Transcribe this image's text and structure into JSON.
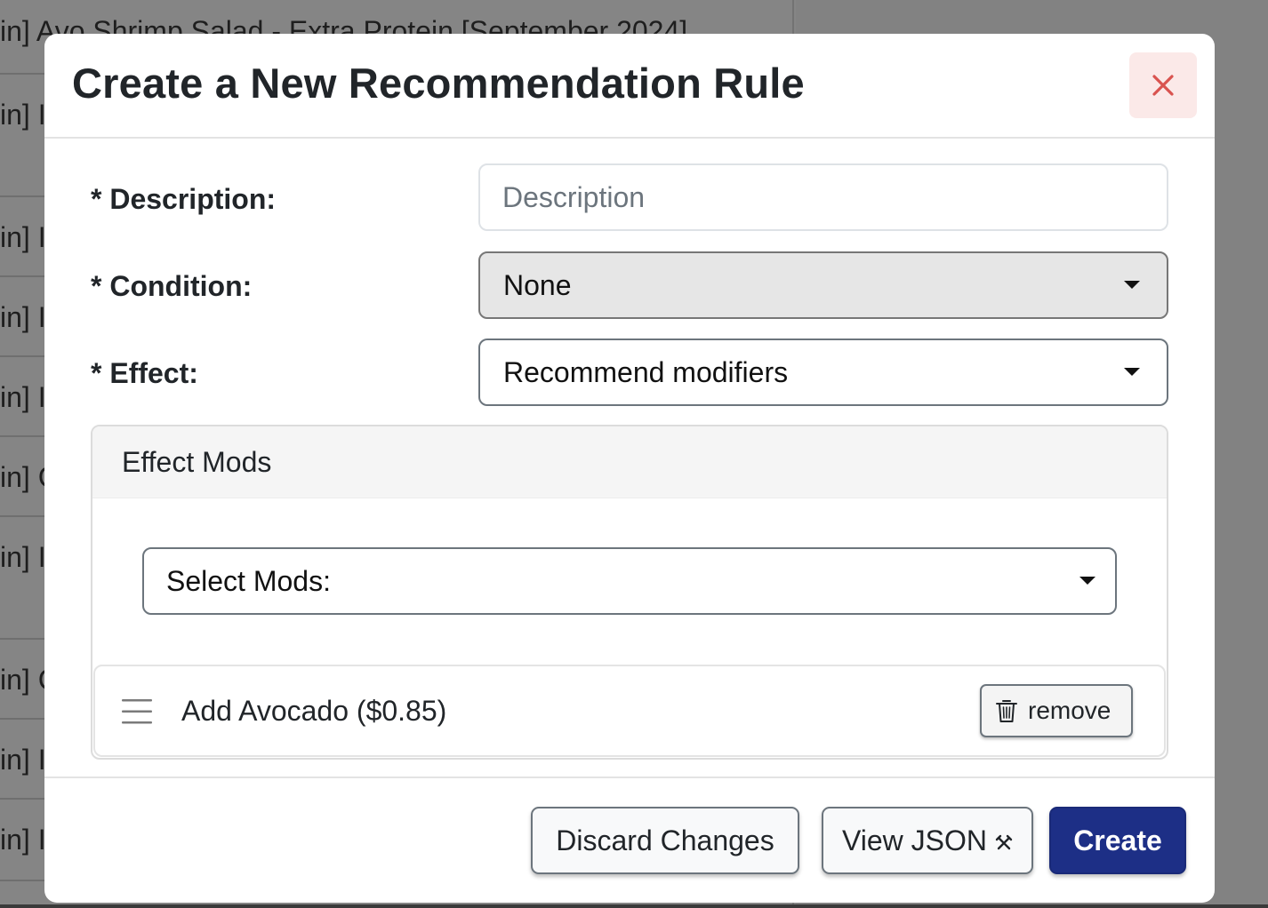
{
  "background": {
    "rows": [
      "in] Avo Shrimp Salad - Extra Protein [September 2024]",
      "in] I",
      "in] I",
      "in] I",
      "in] I",
      "in] C",
      "in] I",
      "in] C",
      "in] I",
      "in] I"
    ]
  },
  "modal": {
    "title": "Create a New Recommendation Rule",
    "close_icon": "close-icon",
    "fields": {
      "description": {
        "label": "* Description:",
        "placeholder": "Description",
        "value": ""
      },
      "condition": {
        "label": "* Condition:",
        "value": "None",
        "disabled": true
      },
      "effect": {
        "label": "* Effect:",
        "value": "Recommend modifiers"
      }
    },
    "effect_mods": {
      "header": "Effect Mods",
      "select_placeholder": "Select Mods:",
      "items": [
        {
          "label": "Add Avocado ($0.85)",
          "remove_label": "remove",
          "handle_icon": "drag-handle-icon",
          "remove_icon": "trash-icon"
        }
      ]
    },
    "footer": {
      "discard_label": "Discard Changes",
      "view_json_label": "View JSON",
      "view_json_icon": "hammer-wrench-icon",
      "create_label": "Create"
    }
  },
  "colors": {
    "overlay": "#858585",
    "primary": "#1d2f86",
    "close_bg": "#fbe9e8",
    "close_x": "#d9534f"
  }
}
